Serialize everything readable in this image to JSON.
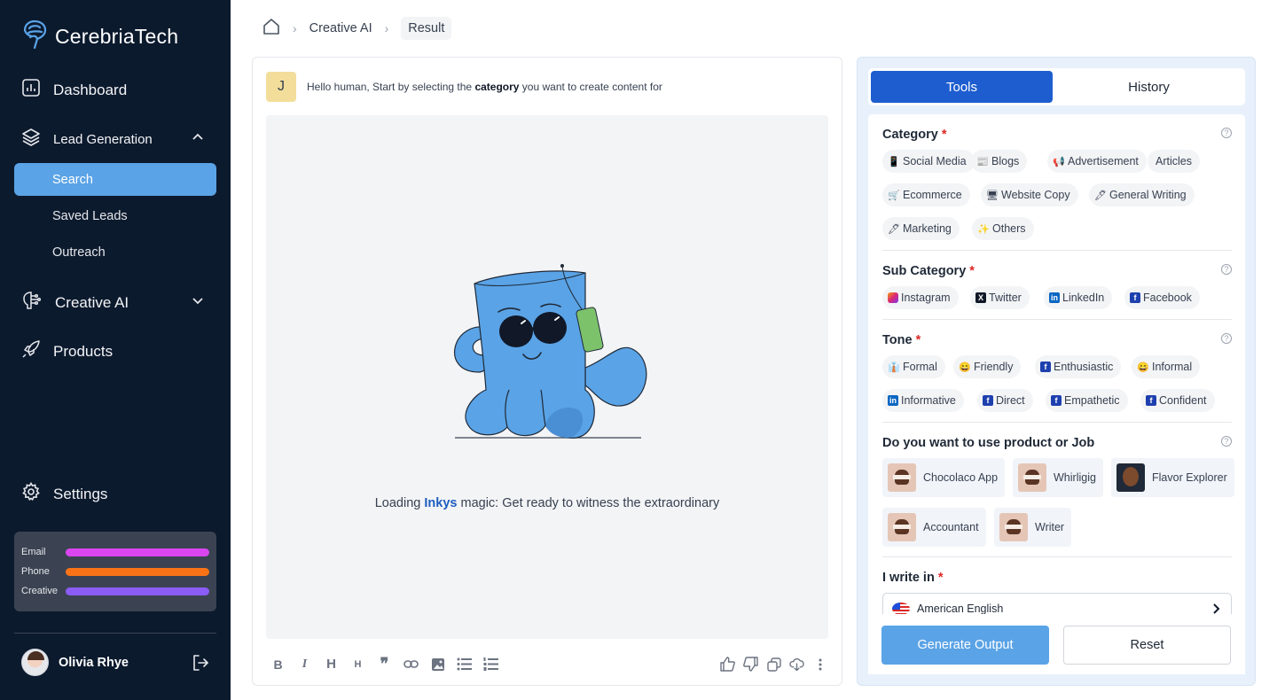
{
  "brand": {
    "name": "CerebriaTech"
  },
  "sidebar": {
    "dashboard": "Dashboard",
    "lead_generation": "Lead Generation",
    "sub_items": [
      "Search",
      "Saved Leads",
      "Outreach"
    ],
    "creative_ai": "Creative AI",
    "products": "Products",
    "settings": "Settings",
    "usage": [
      {
        "label": "Email",
        "color": "#d946ef"
      },
      {
        "label": "Phone",
        "color": "#f97316"
      },
      {
        "label": "Creative",
        "color": "#8b5cf6"
      }
    ],
    "user_name": "Olivia Rhye"
  },
  "breadcrumb": {
    "items": [
      "Creative AI",
      "Result"
    ]
  },
  "chat": {
    "avatar_initial": "J",
    "message_prefix": "Hello human, Start by selecting the ",
    "message_bold": "category",
    "message_suffix": " you want to create content for",
    "mascot_tag": "Inky",
    "loading_prefix": "Loading ",
    "loading_highlight": "Inkys",
    "loading_suffix": " magic: Get ready to witness the extraordinary"
  },
  "panel": {
    "tabs": [
      "Tools",
      "History"
    ],
    "category": {
      "title": "Category",
      "required": "*",
      "chips": [
        {
          "icon": "📱",
          "label": "Social Media"
        },
        {
          "icon": "📰",
          "label": "Blogs"
        },
        {
          "icon": "📢",
          "label": "Advertisement"
        },
        {
          "icon": "",
          "label": "Articles"
        },
        {
          "icon": "🛒",
          "label": "Ecommerce"
        },
        {
          "icon": "🖥",
          "label": "Website Copy"
        },
        {
          "icon": "🖊",
          "label": "General Writing"
        },
        {
          "icon": "🖊",
          "label": "Marketing"
        },
        {
          "icon": "✨",
          "label": "Others"
        }
      ]
    },
    "sub_category": {
      "title": "Sub Category",
      "required": "*",
      "chips": [
        "Instagram",
        "Twitter",
        "LinkedIn",
        "Facebook"
      ]
    },
    "tone": {
      "title": "Tone",
      "required": "*",
      "chips": [
        {
          "icon": "👔",
          "label": "Formal"
        },
        {
          "icon": "😄",
          "label": "Friendly"
        },
        {
          "icon": "f",
          "label": "Enthusiastic"
        },
        {
          "icon": "😄",
          "label": "Informal"
        },
        {
          "icon": "in",
          "label": "Informative"
        },
        {
          "icon": "f",
          "label": "Direct"
        },
        {
          "icon": "f",
          "label": "Empathetic"
        },
        {
          "icon": "f",
          "label": "Confident"
        }
      ]
    },
    "product": {
      "title": "Do you want to use product or Job",
      "items": [
        "Chocolaco App",
        "Whirligig",
        "Flavor Explorer",
        "Accountant",
        "Writer"
      ]
    },
    "language": {
      "title": "I write in",
      "required": "*",
      "value": "American English"
    },
    "generate_label": "Generate Output",
    "reset_label": "Reset"
  }
}
